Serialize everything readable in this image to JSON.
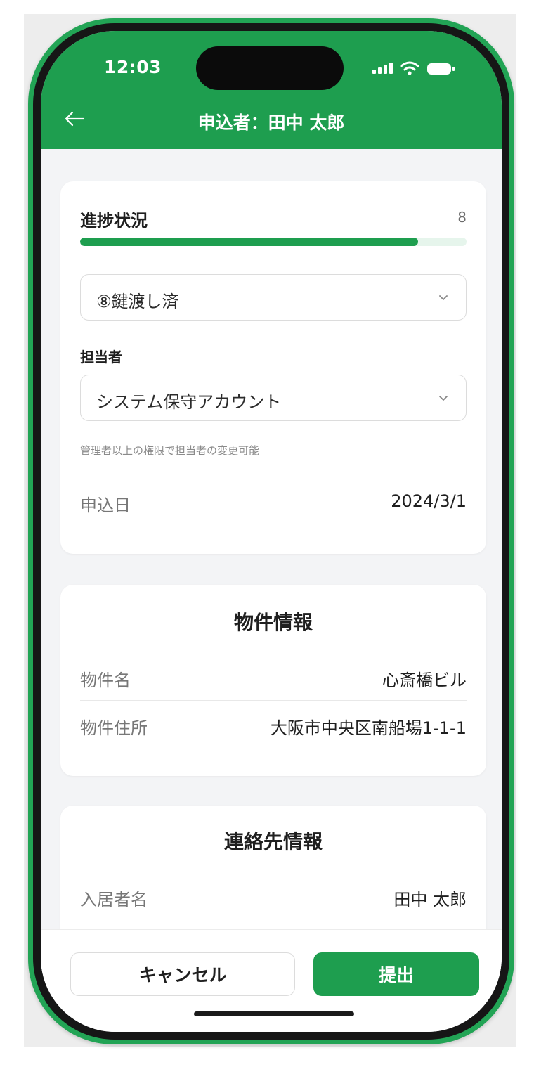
{
  "status_bar": {
    "time": "12:03"
  },
  "header": {
    "title": "申込者：田中 太郎"
  },
  "progress": {
    "label": "進捗状況",
    "step": "8",
    "fraction": 0.875,
    "status_selected": "⑧鍵渡し済"
  },
  "assignee": {
    "label": "担当者",
    "selected": "システム保守アカウント",
    "note": "管理者以上の権限で担当者の変更可能"
  },
  "application_date": {
    "label": "申込日",
    "value": "2024/3/1"
  },
  "property": {
    "title": "物件情報",
    "rows": [
      {
        "label": "物件名",
        "value": "心斎橋ビル"
      },
      {
        "label": "物件住所",
        "value": "大阪市中央区南船場1-1-1"
      }
    ]
  },
  "contact": {
    "title": "連絡先情報",
    "rows": [
      {
        "label": "入居者名",
        "value": "田中 太郎"
      }
    ]
  },
  "footer": {
    "cancel_label": "キャンセル",
    "submit_label": "提出"
  },
  "colors": {
    "primary": "#1e9e4f",
    "frame": "#22a455"
  }
}
